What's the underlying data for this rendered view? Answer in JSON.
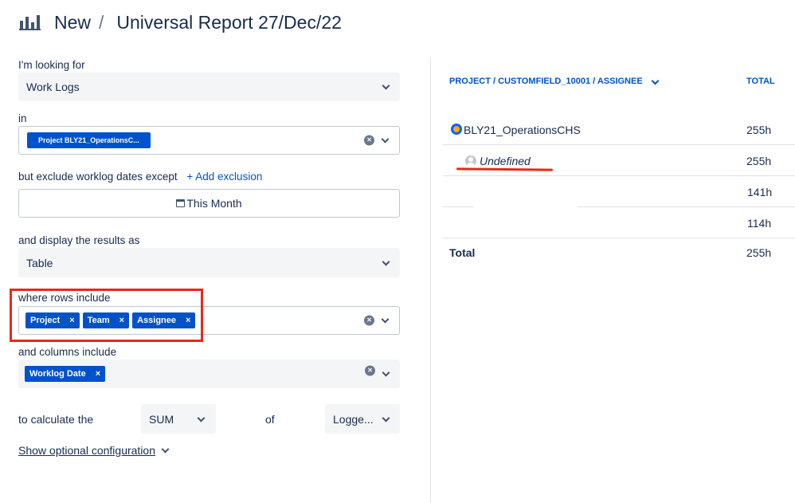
{
  "header": {
    "icon": "bar-chart-icon",
    "crumb": "New",
    "separator": "/",
    "title": "Universal Report 27/Dec/22"
  },
  "form": {
    "looking_for_label": "I'm looking for",
    "looking_for_value": "Work Logs",
    "in_label": "in",
    "in_chip": "Project BLY21_OperationsC...",
    "exclude_label": "but exclude worklog dates except",
    "add_exclusion": "+ Add exclusion",
    "month_button": "This Month",
    "display_label": "and display the results as",
    "display_value": "Table",
    "rows_label": "where rows include",
    "rows_chips": [
      "Project",
      "Team",
      "Assignee"
    ],
    "columns_label": "and columns include",
    "columns_chips": [
      "Worklog Date"
    ],
    "calculate_label": "to calculate the",
    "calculate_value": "SUM",
    "of_label": "of",
    "of_value": "Logge...",
    "optional_config": "Show optional configuration",
    "chip_remove": "×"
  },
  "table": {
    "col_group": "PROJECT / CUSTOMFIELD_10001 / ASSIGNEE",
    "col_total": "TOTAL",
    "rows": [
      {
        "label": "BLY21_OperationsCHS",
        "total": "255h"
      },
      {
        "label": "Undefined",
        "total": "255h"
      },
      {
        "label": "",
        "total": "141h"
      },
      {
        "label": "",
        "total": "114h"
      }
    ],
    "footer_label": "Total",
    "footer_total": "255h"
  },
  "colors": {
    "accent": "#0052cc",
    "annotation_red": "#e8291a"
  }
}
